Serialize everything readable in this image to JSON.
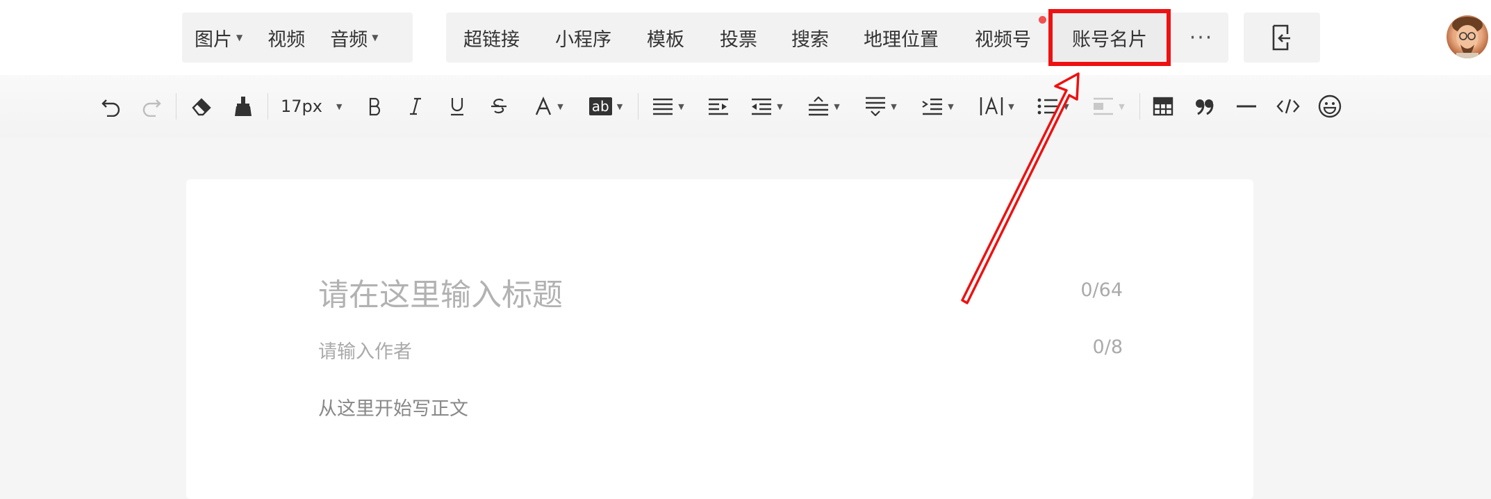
{
  "insert_bar": {
    "media": [
      {
        "label": "图片",
        "has_dropdown": true
      },
      {
        "label": "视频",
        "has_dropdown": false
      },
      {
        "label": "音频",
        "has_dropdown": true
      }
    ],
    "tools": [
      "超链接",
      "小程序",
      "模板",
      "投票",
      "搜索",
      "地理位置",
      "视频号"
    ],
    "highlighted_tool": "账号名片",
    "more_label": "···"
  },
  "format_toolbar": {
    "font_size": "17px",
    "icons": [
      "undo-icon",
      "redo-icon",
      "eraser-icon",
      "format-painter-icon",
      "font-size-select",
      "bold-icon",
      "italic-icon",
      "underline-icon",
      "strikethrough-icon",
      "font-color-icon",
      "background-color-icon",
      "align-icon",
      "indent-icon",
      "outdent-icon",
      "line-height-icon",
      "paragraph-spacing-icon",
      "text-indent-icon",
      "letter-spacing-icon",
      "list-icon",
      "image-align-icon",
      "table-icon",
      "quote-icon",
      "divider-icon",
      "code-icon",
      "emoji-icon"
    ],
    "background_color_label": "ab"
  },
  "editor": {
    "title_placeholder": "请在这里输入标题",
    "title_count": "0/64",
    "author_placeholder": "请输入作者",
    "author_count": "0/8",
    "body_placeholder": "从这里开始写正文"
  },
  "colors": {
    "highlight_border": "#ee1111",
    "notification_dot": "#f2504f",
    "arrow": "#ee1111"
  }
}
